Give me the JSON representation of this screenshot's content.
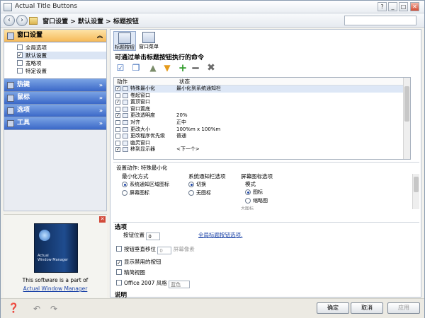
{
  "window": {
    "title": "Actual Title Buttons"
  },
  "titlebar_buttons": [
    "?",
    "_",
    "□",
    "✕"
  ],
  "breadcrumb": [
    "窗口设置",
    ">",
    "默认设置",
    ">",
    "标题按钮"
  ],
  "sidebar": {
    "sections": [
      {
        "label": "窗口设置",
        "chevron": "»",
        "active": true
      },
      {
        "label": "热键",
        "chevron": "»"
      },
      {
        "label": "鼠标",
        "chevron": "»"
      },
      {
        "label": "选项",
        "chevron": "»"
      },
      {
        "label": "工具",
        "chevron": "»"
      }
    ],
    "subitems": [
      {
        "label": "全局选项",
        "checked": false
      },
      {
        "label": "默认设置",
        "checked": true
      },
      {
        "label": "宽略项",
        "checked": false
      },
      {
        "label": "特定设置",
        "checked": false
      }
    ]
  },
  "promo": {
    "box_line1": "Actual",
    "box_line2": "Window Manager",
    "text": "This software is a part of",
    "link": "Actual Window Manager"
  },
  "tabs": [
    "标题按钮",
    "窗口菜单"
  ],
  "main": {
    "section_title": "可通过单击标题按钮执行的命令",
    "columns": [
      "动作",
      "状态"
    ],
    "commands": [
      {
        "checked": true,
        "name": "特殊最小化",
        "state": "最小化到系统通知栏",
        "selected": true
      },
      {
        "checked": false,
        "name": "卷起窗口",
        "state": ""
      },
      {
        "checked": true,
        "name": "置顶窗口",
        "state": ""
      },
      {
        "checked": false,
        "name": "窗口置底",
        "state": ""
      },
      {
        "checked": true,
        "name": "更改透明度",
        "state": "20%"
      },
      {
        "checked": false,
        "name": "对齐",
        "state": "正中"
      },
      {
        "checked": false,
        "name": "更改大小",
        "state": "100%m x 100%m"
      },
      {
        "checked": false,
        "name": "更改程序优先级",
        "state": "普通"
      },
      {
        "checked": false,
        "name": "幽灵窗口",
        "state": ""
      },
      {
        "checked": true,
        "name": "移到显示器",
        "state": "<下一个>"
      }
    ],
    "settings_title": "设置动作: 特殊最小化",
    "minimize_group": {
      "label": "最小化方式",
      "options": [
        "系统通知区域图标",
        "屏幕图标"
      ],
      "selected": 0
    },
    "tray_group": {
      "label": "系统通知栏选项",
      "options": [
        "切换",
        "无图标"
      ],
      "selected": 0
    },
    "screen_group": {
      "label": "屏幕图标选项",
      "sub_label": "模式",
      "options": [
        "图标",
        "缩略图"
      ],
      "selected": 0,
      "cut_label": "大图标"
    },
    "options_title": "选项",
    "button_position_label": "按钮位置",
    "button_position_value": "0",
    "global_link": "全局标题按钮选项.",
    "vertical_offset_label": "按钮垂直移位",
    "vertical_offset_value": "0",
    "vertical_offset_unit": "屏幕像素",
    "show_disabled_label": "显示禁用的按钮",
    "compact_view_label": "精简视图",
    "office_style_label": "Office 2007 风格",
    "office_style_value": "蓝色",
    "desc_title": "说明"
  },
  "buttons": {
    "ok": "确定",
    "cancel": "取消",
    "apply": "应用"
  }
}
